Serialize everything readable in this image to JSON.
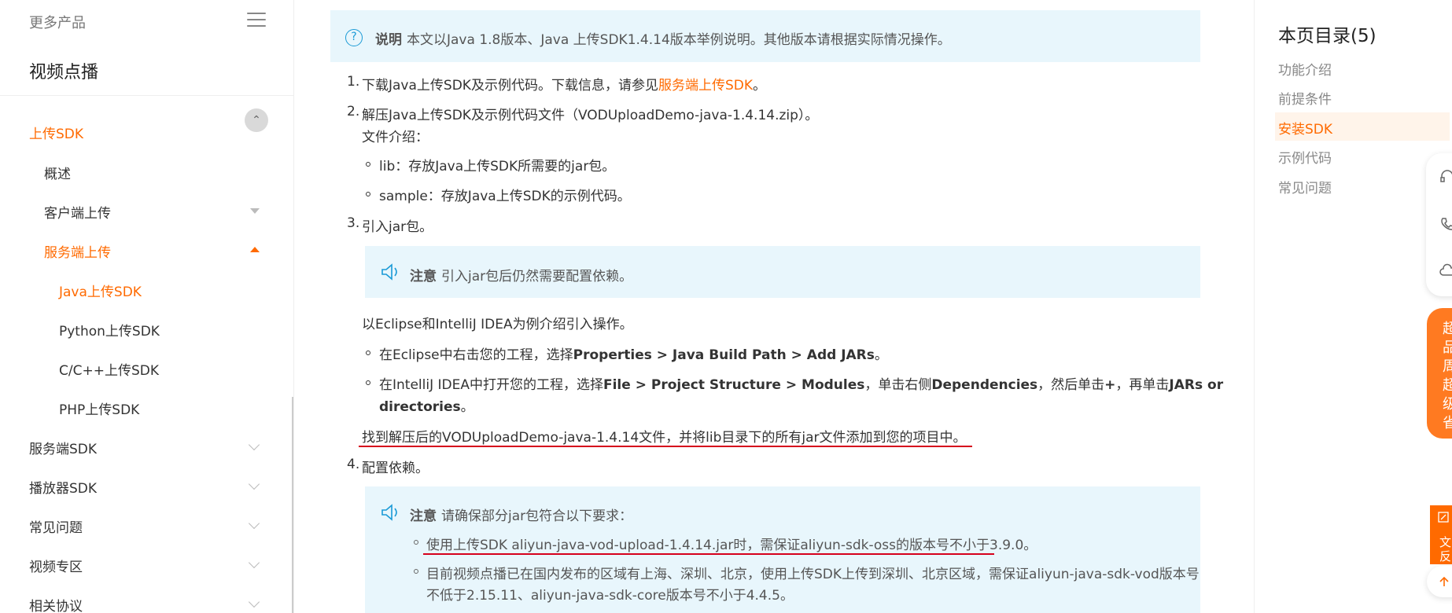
{
  "sidebar": {
    "more_products": "更多产品",
    "title": "视频点播",
    "items": [
      {
        "label": "上传SDK",
        "state": "active-partial"
      },
      {
        "label": "概述"
      },
      {
        "label": "客户端上传"
      },
      {
        "label": "服务端上传"
      },
      {
        "label": "Java上传SDK"
      },
      {
        "label": "Python上传SDK"
      },
      {
        "label": "C/C++上传SDK"
      },
      {
        "label": "PHP上传SDK"
      },
      {
        "label": "服务端SDK"
      },
      {
        "label": "播放器SDK"
      },
      {
        "label": "常见问题"
      },
      {
        "label": "视频专区"
      },
      {
        "label": "相关协议"
      }
    ]
  },
  "content": {
    "note1": {
      "label": "说明",
      "text": "本文以Java 1.8版本、Java 上传SDK1.4.14版本举例说明。其他版本请根据实际情况操作。"
    },
    "step1": {
      "num": "1.",
      "text": "下载Java上传SDK及示例代码。下载信息，请参见",
      "link": "服务端上传SDK",
      "end": "。"
    },
    "step2": {
      "num": "2.",
      "text": "解压Java上传SDK及示例代码文件（VODUploadDemo-java-1.4.14.zip）。",
      "sub": "文件介绍："
    },
    "step2_bullets": [
      "lib：存放Java上传SDK所需要的jar包。",
      "sample：存放Java上传SDK的示例代码。"
    ],
    "step3": {
      "num": "3.",
      "text": "引入jar包。"
    },
    "note2": {
      "label": "注意",
      "text": "引入jar包后仍然需要配置依赖。"
    },
    "intro": "以Eclipse和IntelliJ IDEA为例介绍引入操作。",
    "eclipse": {
      "pre": "在Eclipse中右击您的工程，选择",
      "bold": "Properties > Java Build Path > Add JARs",
      "end": "。"
    },
    "idea": {
      "pre": "在IntelliJ IDEA中打开您的工程，选择",
      "b1": "File > Project Structure > Modules",
      "mid1": "，单击右侧",
      "b2": "Dependencies",
      "mid2": "，然后单击",
      "b3": "+",
      "mid3": "，再单击",
      "b4": "JARs or",
      "b5": "directories",
      "end": "。"
    },
    "find": "找到解压后的VODUploadDemo-java-1.4.14文件，并将lib目录下的所有jar文件添加到您的项目中。",
    "step4": {
      "num": "4.",
      "text": "配置依赖。"
    },
    "note3": {
      "label": "注意",
      "text": "请确保部分jar包符合以下要求：",
      "bullet1": "使用上传SDK aliyun-java-vod-upload-1.4.14.jar时，需保证aliyun-sdk-oss的版本号不小于3.9.0。",
      "bullet2a": "目前视频点播已在国内发布的区域有上海、深圳、北京，使用上传SDK上传到深圳、北京区域，需保证aliyun-java-sdk-vod版本号",
      "bullet2b": "不低于2.15.11、aliyun-java-sdk-core版本号不小于4.4.5。"
    }
  },
  "toc": {
    "title": "本页目录(5)",
    "items": [
      "功能介绍",
      "前提条件",
      "安装SDK",
      "示例代码",
      "常见问题"
    ],
    "active_index": 2
  },
  "widgets": {
    "promo_chars": [
      "超",
      "品",
      "周",
      "超",
      "级",
      "省"
    ],
    "feedback_chars": [
      "文",
      "反"
    ]
  },
  "colors": {
    "accent": "#ff6a00",
    "note_bg": "#e8f6fc",
    "info_blue": "#1a9ad6",
    "underline_red": "#d6001c"
  }
}
